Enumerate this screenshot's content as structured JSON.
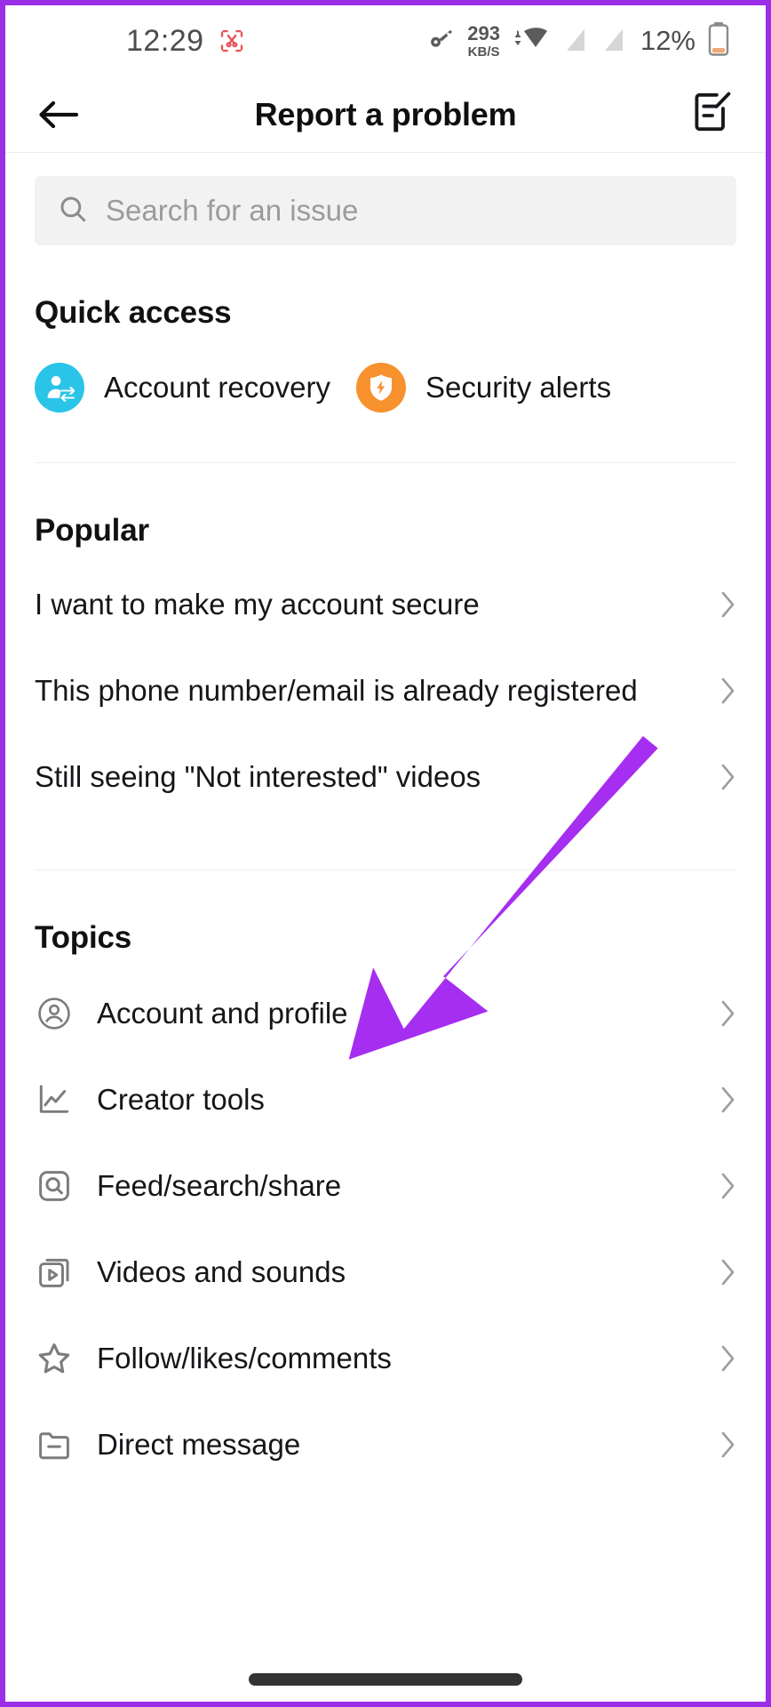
{
  "statusbar": {
    "time": "12:29",
    "screenshot_icon": "scissors-icon",
    "vpn_icon": "key-icon",
    "network_speed_value": "293",
    "network_speed_unit": "KB/S",
    "wifi_icon": "wifi-icon",
    "sim1_icon": "no-sim-icon",
    "sim2_icon": "no-sim-icon",
    "battery_percent": "12%",
    "battery_icon": "battery-low-icon"
  },
  "header": {
    "back_icon": "arrow-left-icon",
    "title": "Report a problem",
    "edit_icon": "note-edit-icon"
  },
  "search": {
    "icon": "search-icon",
    "placeholder": "Search for an issue",
    "value": ""
  },
  "quick_access": {
    "title": "Quick access",
    "items": [
      {
        "label": "Account recovery",
        "icon": "account-recovery-icon",
        "color": "#29c4e8"
      },
      {
        "label": "Security alerts",
        "icon": "shield-bolt-icon",
        "color": "#f7922f"
      }
    ]
  },
  "popular": {
    "title": "Popular",
    "items": [
      {
        "label": "I want to make my account secure",
        "chevron": "chevron-right-icon"
      },
      {
        "label": "This phone number/email is already registered",
        "chevron": "chevron-right-icon"
      },
      {
        "label": "Still seeing \"Not interested\" videos",
        "chevron": "chevron-right-icon"
      }
    ]
  },
  "topics": {
    "title": "Topics",
    "items": [
      {
        "label": "Account and profile",
        "icon": "person-circle-icon",
        "chevron": "chevron-right-icon"
      },
      {
        "label": "Creator tools",
        "icon": "analytics-chart-icon",
        "chevron": "chevron-right-icon"
      },
      {
        "label": "Feed/search/share",
        "icon": "search-square-icon",
        "chevron": "chevron-right-icon"
      },
      {
        "label": "Videos and sounds",
        "icon": "video-stack-icon",
        "chevron": "chevron-right-icon"
      },
      {
        "label": "Follow/likes/comments",
        "icon": "star-icon",
        "chevron": "chevron-right-icon"
      },
      {
        "label": "Direct message",
        "icon": "folder-minus-icon",
        "chevron": "chevron-right-icon"
      }
    ]
  },
  "annotation": {
    "arrow_icon": "pointer-arrow-icon",
    "arrow_color": "#a62ef0",
    "points_to": "Account and profile"
  },
  "system": {
    "home_indicator": "home-indicator",
    "frame_color": "#9b2fe8"
  }
}
